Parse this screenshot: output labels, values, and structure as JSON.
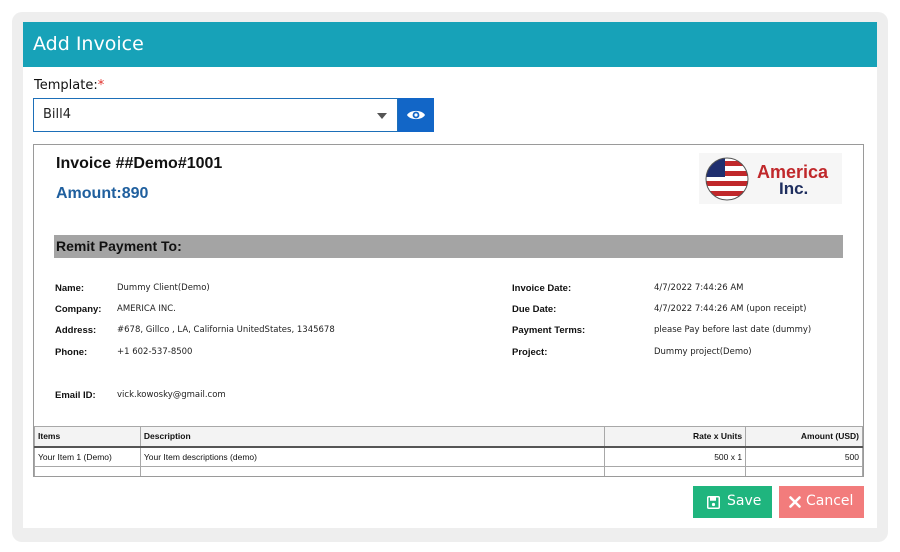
{
  "modal": {
    "title": "Add Invoice"
  },
  "template": {
    "label": "Template:",
    "required_mark": "*",
    "selected": "Bill4",
    "preview_icon": "eye-icon"
  },
  "invoice": {
    "title": "Invoice ##Demo#1001",
    "amount": "Amount:890",
    "logo": {
      "line1": "America",
      "line2": "Inc."
    },
    "remit_heading": "Remit Payment To:",
    "left_fields": [
      {
        "label": "Name:",
        "value": "Dummy Client(Demo)"
      },
      {
        "label": "Company:",
        "value": "AMERICA INC."
      },
      {
        "label": "Address:",
        "value": "#678, Gillco , LA, California UnitedStates, 1345678"
      },
      {
        "label": "Phone:",
        "value": "+1 602-537-8500"
      }
    ],
    "email": {
      "label": "Email ID:",
      "value": "vick.kowosky@gmail.com"
    },
    "right_fields": [
      {
        "label": "Invoice Date:",
        "value": "4/7/2022 7:44:26 AM"
      },
      {
        "label": "Due Date:",
        "value": "4/7/2022 7:44:26 AM (upon receipt)"
      },
      {
        "label": "Payment Terms:",
        "value": "please Pay before last date (dummy)"
      },
      {
        "label": "Project:",
        "value": "Dummy project(Demo)"
      }
    ],
    "table": {
      "headers": [
        "Items",
        "Description",
        "Rate x Units",
        "Amount (USD)"
      ],
      "rows": [
        [
          "Your Item 1 (Demo)",
          "Your Item descriptions (demo)",
          "500 x 1",
          "500"
        ]
      ]
    }
  },
  "footer": {
    "save_label": "Save",
    "cancel_label": "Cancel"
  },
  "colors": {
    "header": "#17a2b8",
    "save": "#1fb57e",
    "cancel": "#f27c7c",
    "primary": "#1266c7"
  }
}
